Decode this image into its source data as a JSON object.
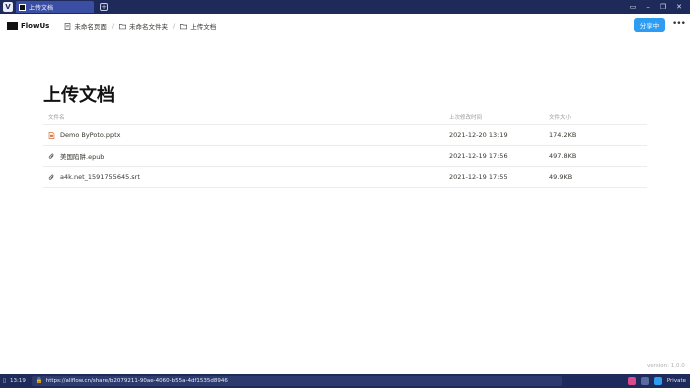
{
  "browser": {
    "tab_title": "上传文档",
    "new_tab": "+",
    "url": "https://allflow.cn/share/b2079211-90ae-4060-b55a-4df1535d8946",
    "time": "13:19",
    "private_label": "Private"
  },
  "header": {
    "brand": "FlowUs",
    "breadcrumbs": [
      {
        "label": "未命名页面",
        "icon": "page-icon"
      },
      {
        "label": "未命名文件夹",
        "icon": "folder-icon"
      },
      {
        "label": "上传文档",
        "icon": "folder-icon"
      }
    ],
    "share_label": "分享中",
    "more_label": "•••"
  },
  "page": {
    "title": "上传文档",
    "columns": [
      "文件名",
      "上次修改时间",
      "文件大小"
    ],
    "files": [
      {
        "name": "Demo ByPoto.pptx",
        "modified": "2021-12-20 13:19",
        "size": "174.2KB",
        "icon": "pptx-file-icon"
      },
      {
        "name": "美国陷阱.epub",
        "modified": "2021-12-19 17:56",
        "size": "497.8KB",
        "icon": "attachment-icon"
      },
      {
        "name": "a4k.net_1591755645.srt",
        "modified": "2021-12-19 17:55",
        "size": "49.9KB",
        "icon": "attachment-icon"
      }
    ]
  },
  "footer": {
    "version": "version: 1.0.0"
  },
  "colors": {
    "accent": "#2e9cf0",
    "browser_chrome": "#1e2a5a",
    "active_tab": "#3a4fa3"
  }
}
